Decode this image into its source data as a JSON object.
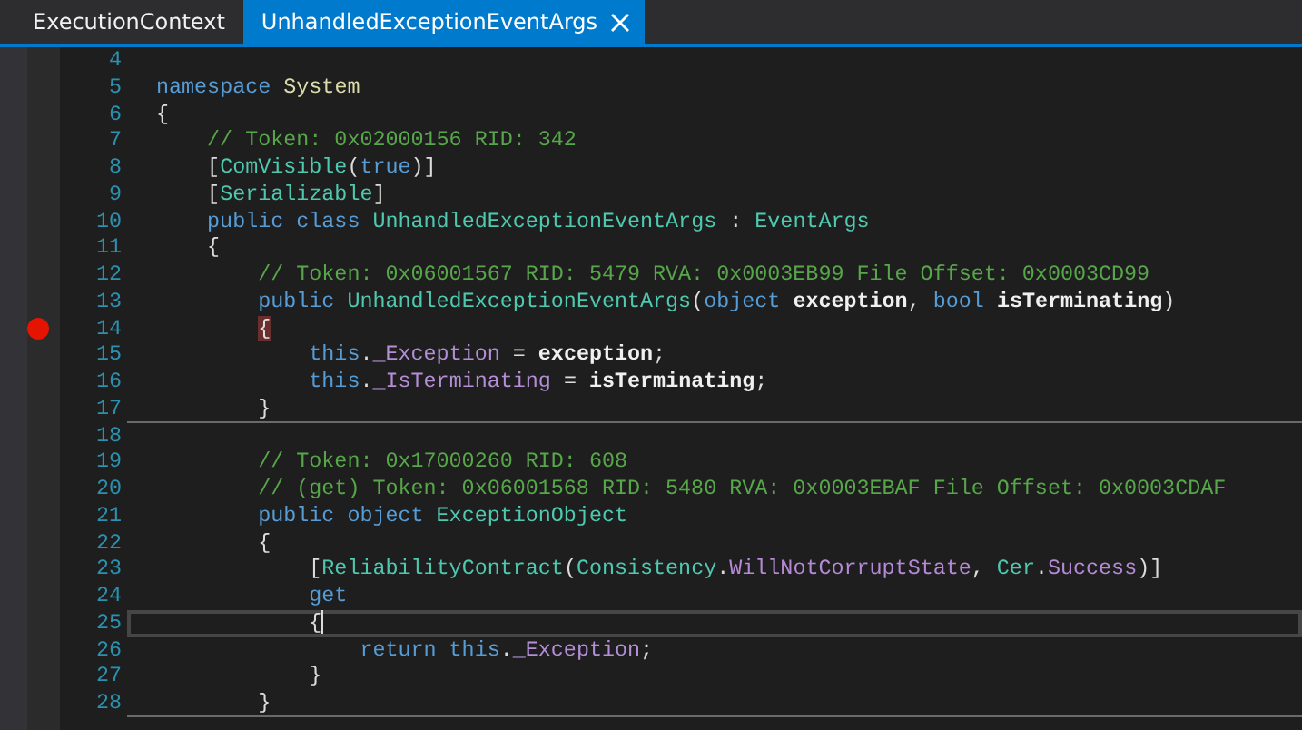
{
  "tabs": [
    {
      "label": "ExecutionContext",
      "selected": false
    },
    {
      "label": "UnhandledExceptionEventArgs",
      "selected": true
    }
  ],
  "editor": {
    "lines": [
      {
        "number": "4"
      },
      {
        "number": "5",
        "tokens": [
          {
            "kind": "keyword",
            "text": "namespace "
          },
          {
            "kind": "namespace",
            "text": "System"
          }
        ]
      },
      {
        "number": "6",
        "tokens": [
          {
            "kind": "plain",
            "text": "{"
          }
        ],
        "children": [
          {
            "number": "7",
            "tokens": [
              {
                "kind": "comment",
                "text": "// Token: 0x02000156 RID: 342"
              }
            ]
          },
          {
            "number": "8",
            "tokens": [
              {
                "kind": "plain",
                "text": "["
              },
              {
                "kind": "type",
                "text": "ComVisible"
              },
              {
                "kind": "plain",
                "text": "("
              },
              {
                "kind": "keyword",
                "text": "true"
              },
              {
                "kind": "plain",
                "text": ")]"
              }
            ]
          },
          {
            "number": "9",
            "tokens": [
              {
                "kind": "plain",
                "text": "["
              },
              {
                "kind": "type",
                "text": "Serializable"
              },
              {
                "kind": "plain",
                "text": "]"
              }
            ]
          },
          {
            "number": "10",
            "tokens": [
              {
                "kind": "keyword",
                "text": "public class "
              },
              {
                "kind": "type",
                "text": "UnhandledExceptionEventArgs"
              },
              {
                "kind": "plain",
                "text": " : "
              },
              {
                "kind": "type",
                "text": "EventArgs"
              }
            ]
          },
          {
            "number": "11",
            "tokens": [
              {
                "kind": "plain",
                "text": "{"
              }
            ],
            "children": [
              {
                "number": "12",
                "tokens": [
                  {
                    "kind": "comment",
                    "text": "// Token: 0x06001567 RID: 5479 RVA: 0x0003EB99 File Offset: 0x0003CD99"
                  }
                ]
              },
              {
                "number": "13",
                "tokens": [
                  {
                    "kind": "keyword",
                    "text": "public "
                  },
                  {
                    "kind": "type",
                    "text": "UnhandledExceptionEventArgs"
                  },
                  {
                    "kind": "plain",
                    "text": "("
                  },
                  {
                    "kind": "keyword",
                    "text": "object "
                  },
                  {
                    "kind": "parameter",
                    "text": "exception"
                  },
                  {
                    "kind": "plain",
                    "text": ", "
                  },
                  {
                    "kind": "keyword",
                    "text": "bool "
                  },
                  {
                    "kind": "parameter",
                    "text": "isTerminating"
                  },
                  {
                    "kind": "plain",
                    "text": ")"
                  }
                ]
              },
              {
                "number": "14",
                "tokens": [
                  {
                    "kind": "matched-brace",
                    "text": "{"
                  }
                ],
                "breakpoint": true,
                "children": [
                  {
                    "number": "15",
                    "tokens": [
                      {
                        "kind": "keyword",
                        "text": "this"
                      },
                      {
                        "kind": "plain",
                        "text": "."
                      },
                      {
                        "kind": "field",
                        "text": "_Exception"
                      },
                      {
                        "kind": "plain",
                        "text": " = "
                      },
                      {
                        "kind": "parameter",
                        "text": "exception"
                      },
                      {
                        "kind": "plain",
                        "text": ";"
                      }
                    ]
                  },
                  {
                    "number": "16",
                    "tokens": [
                      {
                        "kind": "keyword",
                        "text": "this"
                      },
                      {
                        "kind": "plain",
                        "text": "."
                      },
                      {
                        "kind": "field",
                        "text": "_IsTerminating"
                      },
                      {
                        "kind": "plain",
                        "text": " = "
                      },
                      {
                        "kind": "parameter",
                        "text": "isTerminating"
                      },
                      {
                        "kind": "plain",
                        "text": ";"
                      }
                    ]
                  }
                ]
              },
              {
                "number": "17",
                "tokens": [
                  {
                    "kind": "plain",
                    "text": "}"
                  }
                ],
                "separator_after": true
              },
              {
                "number": "18"
              },
              {
                "number": "19",
                "tokens": [
                  {
                    "kind": "comment",
                    "text": "// Token: 0x17000260 RID: 608"
                  }
                ]
              },
              {
                "number": "20",
                "tokens": [
                  {
                    "kind": "comment",
                    "text": "// (get) Token: 0x06001568 RID: 5480 RVA: 0x0003EBAF File Offset: 0x0003CDAF"
                  }
                ]
              },
              {
                "number": "21",
                "tokens": [
                  {
                    "kind": "keyword",
                    "text": "public object "
                  },
                  {
                    "kind": "type",
                    "text": "ExceptionObject"
                  }
                ]
              },
              {
                "number": "22",
                "tokens": [
                  {
                    "kind": "plain",
                    "text": "{"
                  }
                ],
                "children": [
                  {
                    "number": "23",
                    "tokens": [
                      {
                        "kind": "plain",
                        "text": "["
                      },
                      {
                        "kind": "type",
                        "text": "ReliabilityContract"
                      },
                      {
                        "kind": "plain",
                        "text": "("
                      },
                      {
                        "kind": "type",
                        "text": "Consistency"
                      },
                      {
                        "kind": "plain",
                        "text": "."
                      },
                      {
                        "kind": "enum",
                        "text": "WillNotCorruptState"
                      },
                      {
                        "kind": "plain",
                        "text": ", "
                      },
                      {
                        "kind": "type",
                        "text": "Cer"
                      },
                      {
                        "kind": "plain",
                        "text": "."
                      },
                      {
                        "kind": "enum",
                        "text": "Success"
                      },
                      {
                        "kind": "plain",
                        "text": ")]"
                      }
                    ]
                  },
                  {
                    "number": "24",
                    "tokens": [
                      {
                        "kind": "keyword",
                        "text": "get"
                      }
                    ]
                  },
                  {
                    "number": "25",
                    "tokens": [
                      {
                        "kind": "plain",
                        "text": "{"
                      }
                    ],
                    "current": true,
                    "children": [
                      {
                        "number": "26",
                        "tokens": [
                          {
                            "kind": "keyword",
                            "text": "return this"
                          },
                          {
                            "kind": "plain",
                            "text": "."
                          },
                          {
                            "kind": "field",
                            "text": "_Exception"
                          },
                          {
                            "kind": "plain",
                            "text": ";"
                          }
                        ]
                      }
                    ]
                  },
                  {
                    "number": "27",
                    "tokens": [
                      {
                        "kind": "plain",
                        "text": "}"
                      }
                    ]
                  }
                ]
              },
              {
                "number": "28",
                "tokens": [
                  {
                    "kind": "plain",
                    "text": "}"
                  }
                ],
                "separator_after": true
              }
            ]
          }
        ]
      }
    ]
  }
}
